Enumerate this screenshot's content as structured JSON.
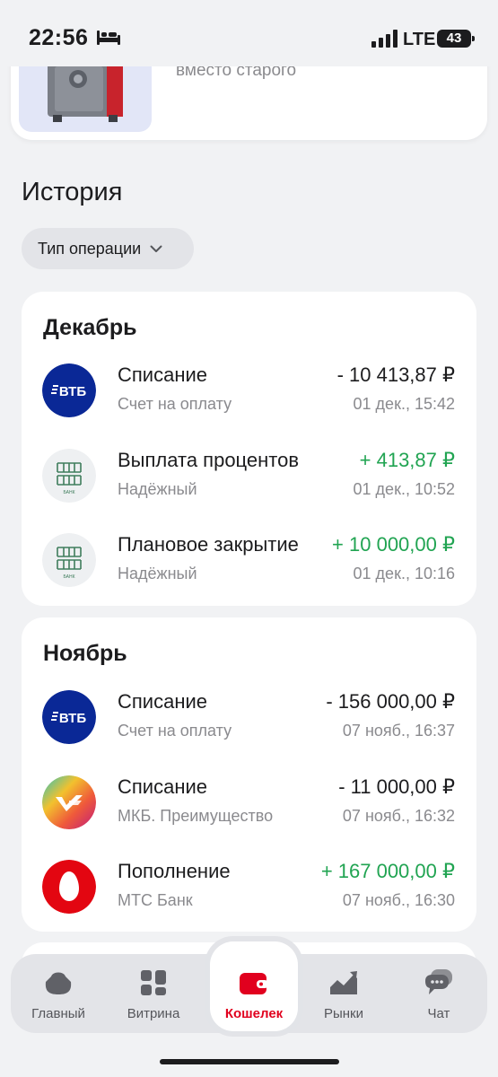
{
  "status_bar": {
    "time": "22:56",
    "network": "LTE",
    "battery": "43"
  },
  "promo": {
    "text": "вместо старого"
  },
  "history": {
    "title": "История",
    "filter_label": "Тип операции"
  },
  "months": [
    {
      "name": "Декабрь",
      "transactions": [
        {
          "logo": "vtb-logo",
          "logo_text": "ВТБ",
          "title": "Списание",
          "subtitle": "Счет на оплату",
          "amount": "- 10 413,87 ₽",
          "date": "01 дек., 15:42",
          "kind": "negative"
        },
        {
          "logo": "domrf-logo",
          "logo_text": "ДОМ РФ",
          "title": "Выплата процентов",
          "subtitle": "Надёжный",
          "amount": "+ 413,87 ₽",
          "date": "01 дек., 10:52",
          "kind": "positive"
        },
        {
          "logo": "domrf-logo",
          "logo_text": "ДОМ РФ",
          "title": "Плановое закрытие",
          "subtitle": "Надёжный",
          "amount": "+ 10 000,00 ₽",
          "date": "01 дек., 10:16",
          "kind": "positive"
        }
      ]
    },
    {
      "name": "Ноябрь",
      "transactions": [
        {
          "logo": "vtb-logo",
          "logo_text": "ВТБ",
          "title": "Списание",
          "subtitle": "Счет на оплату",
          "amount": "- 156 000,00 ₽",
          "date": "07 нояб., 16:37",
          "kind": "negative"
        },
        {
          "logo": "mkb-logo",
          "logo_text": "",
          "title": "Списание",
          "subtitle": "МКБ. Преимущество",
          "amount": "- 11 000,00 ₽",
          "date": "07 нояб., 16:32",
          "kind": "negative"
        },
        {
          "logo": "mts-logo",
          "logo_text": "",
          "title": "Пополнение",
          "subtitle": "МТС Банк",
          "amount": "+ 167 000,00 ₽",
          "date": "07 нояб., 16:30",
          "kind": "positive"
        }
      ]
    }
  ],
  "bottom_nav": [
    {
      "label": "Главный",
      "icon": "home-icon",
      "active": false
    },
    {
      "label": "Витрина",
      "icon": "grid-icon",
      "active": false
    },
    {
      "label": "Кошелек",
      "icon": "wallet-icon",
      "active": true
    },
    {
      "label": "Рынки",
      "icon": "chart-icon",
      "active": false
    },
    {
      "label": "Чат",
      "icon": "chat-icon",
      "active": false
    }
  ],
  "colors": {
    "positive": "#21a452",
    "accent": "#e1001e",
    "vtb_blue": "#0a2896",
    "mts_red": "#e30611",
    "domrf_green": "#3f7d5c"
  }
}
